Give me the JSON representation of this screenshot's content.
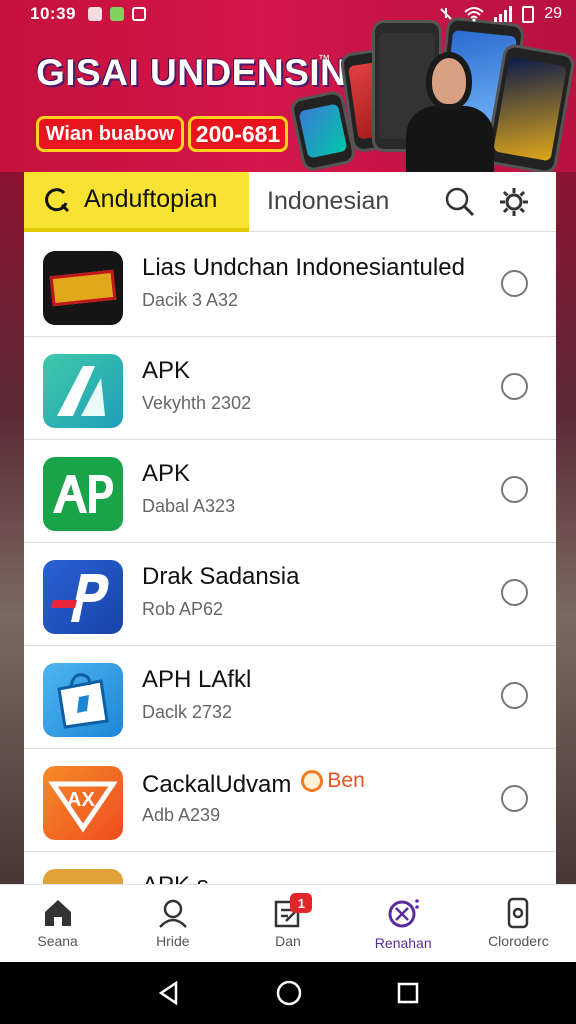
{
  "status_bar": {
    "time": "10:39",
    "battery_text": "29"
  },
  "banner": {
    "title": "GISAI UNDENSIN",
    "trademark": "™",
    "pill_left": "Wian buabow",
    "pill_right": "200-681"
  },
  "tabs": {
    "active_label": "Anduftopian",
    "other_label": "Indonesian"
  },
  "apps": [
    {
      "name": "Lias Undchan Indonesiantuled",
      "sub": "Dacik 3 A32",
      "icon": "game-logo-icon",
      "color": "#1a1a1a"
    },
    {
      "name": "APK",
      "sub": "Vekyhth 2302",
      "icon": "apk-a-logo-icon",
      "color": "#2fb6a2"
    },
    {
      "name": "APK",
      "sub": "Dabal A323",
      "icon": "ap-logo-icon",
      "color": "#1aa44a"
    },
    {
      "name": "Drak Sadansia",
      "sub": "Rob AP62",
      "icon": "p-logo-icon",
      "color": "#2456c6"
    },
    {
      "name": "APH LAfkl",
      "sub": "Daclk 2732",
      "icon": "bag-logo-icon",
      "color": "#2b9be8"
    },
    {
      "name": "CackalUdvam",
      "sub": "Adb A239",
      "icon": "ax-logo-icon",
      "color": "#f26a22",
      "badge": "Ben"
    },
    {
      "name": "APK s",
      "sub": "",
      "icon": "partial-app-icon",
      "color": "#e2a23a"
    }
  ],
  "bottom_nav": [
    {
      "label": "Seana",
      "icon": "home-icon"
    },
    {
      "label": "Hride",
      "icon": "profile-icon"
    },
    {
      "label": "Dan",
      "icon": "edit-note-icon",
      "badge": "1"
    },
    {
      "label": "Renahan",
      "icon": "search-scan-icon",
      "active": true
    },
    {
      "label": "Cloroderc",
      "icon": "phone-device-icon"
    }
  ]
}
